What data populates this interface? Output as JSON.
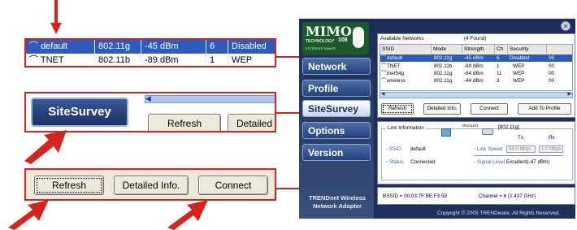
{
  "zoom_table": {
    "rows": [
      {
        "ssid": "default",
        "mode": "802.11g",
        "strength": "-45 dBm",
        "ch": "6",
        "security": "Disabled",
        "selected": true
      },
      {
        "ssid": "TNET",
        "mode": "802.11b",
        "strength": "-89 dBm",
        "ch": "1",
        "security": "WEP",
        "selected": false
      }
    ]
  },
  "zoom_sitesurvey": {
    "nav_label": "SiteSurvey",
    "refresh_label": "Refresh",
    "detailed_label": "Detailed"
  },
  "zoom_buttons": {
    "refresh": "Refresh",
    "detailed": "Detailed Info.",
    "connect": "Connect"
  },
  "app": {
    "logo": {
      "main": "MIMO",
      "sub": "TECHNOLOGY",
      "num": "108",
      "band": "EXTENDED RANGE"
    },
    "nav": [
      {
        "label": "Network",
        "active": false
      },
      {
        "label": "Profile",
        "active": false
      },
      {
        "label": "SiteSurvey",
        "active": true
      },
      {
        "label": "Options",
        "active": false
      },
      {
        "label": "Version",
        "active": false
      }
    ],
    "brand_line1": "TRENDnet Wireless",
    "brand_line2": "Network Adapter",
    "networks_title": "Available Networks",
    "found_count": "(4 Found)",
    "columns": [
      "SSID",
      "Mode",
      "Strength",
      "Ch",
      "Security",
      ""
    ],
    "rows": [
      {
        "ssid": "default",
        "mode": "802.11g",
        "strength": "-45 dBm",
        "ch": "6",
        "security": "Disabled",
        "last": "00",
        "selected": true
      },
      {
        "ssid": "TNET",
        "mode": "802.11b",
        "strength": "-89 dBm",
        "ch": "1",
        "security": "WEP",
        "last": "00",
        "selected": false
      },
      {
        "ssid": "tnet54g",
        "mode": "802.11g",
        "strength": "-64 dBm",
        "ch": "11",
        "security": "WEP",
        "last": "00",
        "selected": false
      },
      {
        "ssid": "wireless",
        "mode": "802.11g",
        "strength": "-44 dBm",
        "ch": "3",
        "security": "WEP",
        "last": "00",
        "selected": false
      }
    ],
    "buttons": {
      "refresh": "Refresh",
      "detailed": "Detailed Info.",
      "connect": "Connect",
      "add_profile": "Add To Profile"
    },
    "link": {
      "group_title": "Link Information",
      "ap_id": "00101101",
      "band": "[802.11g]",
      "tx_label": "Tx",
      "rx_label": "Rx",
      "ssid_label": "- SSID",
      "ssid_value": "default",
      "status_label": "- Status",
      "status_value": "Connected",
      "speed_label": "- Link Speed",
      "tx_speed": "54.0 Mbps",
      "rx_speed": "1.0 Mbps",
      "signal_label": "- Signal Level",
      "signal_value": "Excellent(-47 dBm)"
    },
    "bssid": "BSSID = 00:03:7F:BE:F3:59",
    "channel": "Channel = 6 (2.437 GHz)",
    "copyright": "Copyright © 2005 TRENDware. All Rights Reserved.",
    "colors": {
      "selection": "#2c5bbd",
      "callout": "#d6231f",
      "sidebar": "#1d2f5a"
    }
  }
}
